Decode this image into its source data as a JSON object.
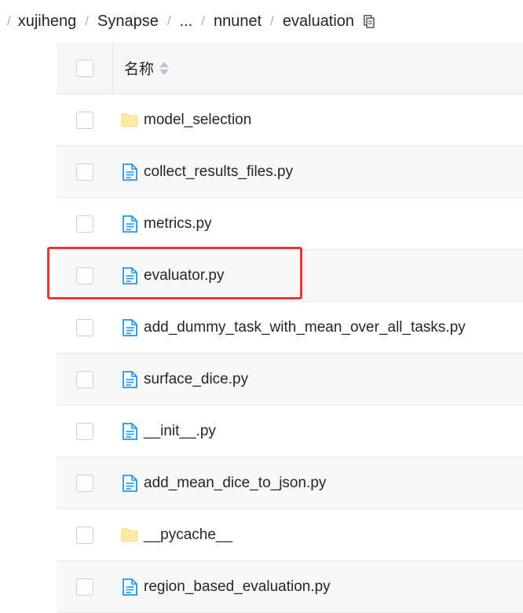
{
  "breadcrumb": {
    "items": [
      "xujiheng",
      "Synapse",
      "...",
      "nnunet",
      "evaluation"
    ],
    "separator": "/"
  },
  "table": {
    "header_name": "名称",
    "rows": [
      {
        "name": "model_selection",
        "type": "folder"
      },
      {
        "name": "collect_results_files.py",
        "type": "file"
      },
      {
        "name": "metrics.py",
        "type": "file"
      },
      {
        "name": "evaluator.py",
        "type": "file"
      },
      {
        "name": "add_dummy_task_with_mean_over_all_tasks.py",
        "type": "file"
      },
      {
        "name": "surface_dice.py",
        "type": "file"
      },
      {
        "name": "__init__.py",
        "type": "file"
      },
      {
        "name": "add_mean_dice_to_json.py",
        "type": "file"
      },
      {
        "name": "__pycache__",
        "type": "folder"
      },
      {
        "name": "region_based_evaluation.py",
        "type": "file"
      }
    ]
  },
  "icons": {
    "file": "file-icon",
    "folder": "folder-icon",
    "copy": "copy-icon",
    "sort": "sort-icon"
  },
  "colors": {
    "file_icon": "#2196f3",
    "folder_icon": "#ffe082",
    "highlight": "#e53935",
    "header_bg": "#f5f6f7",
    "stripe_bg": "#f7f8fa"
  }
}
